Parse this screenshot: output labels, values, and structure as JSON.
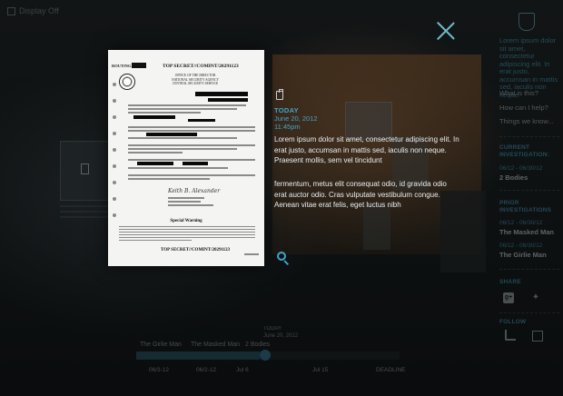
{
  "top_bar": {
    "display_toggle": "Display Off"
  },
  "document": {
    "routing": "ROUTING",
    "classification": "TOP SECRET//COMINT/20291123",
    "office": "OFFICE OF THE DIRECTOR NATIONAL SECURITY AGENCY CENTRAL SECURITY SERVICE",
    "signature": "Keith B. Alexander",
    "special_warning": "Special Warning",
    "footer": "TOP SECRET//COMINT/20291123"
  },
  "detail": {
    "label": "TODAY",
    "date": "June 20, 2012",
    "time": "11:45pm",
    "paragraph1": "Lorem ipsum dolor sit amet, consectetur adipiscing elit. In erat justo, accumsan in mattis sed, iaculis non neque. Praesent mollis, sem vel tincidunt",
    "paragraph2": "fermentum, metus elit consequat odio, id gravida odio erat auctor odio. Cras vulputate vestibulum congue. Aenean vitae erat felis, eget luctus nibh"
  },
  "sidebar": {
    "intro": "Lorem ipsum dolor sit amet, consectetur adipiscing elit. In erat justo, accumsan in mattis sed, iaculis non neque.",
    "links": [
      "What is this?",
      "How can I help?",
      "Things we know..."
    ],
    "current_heading": "CURRENT INVESTIGATION:",
    "current_dates": "06/12 - 06/30/12",
    "current_name": "2 Bodies",
    "prior_heading": "PRIOR INVESTIGATIONS",
    "prior": [
      {
        "dates": "06/12 - 06/30/12",
        "name": "The Masked Man"
      },
      {
        "dates": "06/12 - 06/30/12",
        "name": "The Girlie Man"
      }
    ],
    "share_heading": "SHARE",
    "follow_heading": "FOLLOW",
    "icons": [
      "google-plus-icon",
      "twitter-icon",
      "rss-icon",
      "mail-icon"
    ]
  },
  "timeline": {
    "today": "TODAY",
    "today_date": "June 20, 2012",
    "tags": [
      "The Girlie Man",
      "The Masked Man",
      "2 Bodies"
    ],
    "ticks": [
      "06/3-12",
      "06/2-12",
      "Jul 6",
      "Jul 15",
      "DEADLINE"
    ],
    "progress": 0.47
  },
  "colors": {
    "accent": "#41a5c7",
    "text": "#e9eef0",
    "background": "#0b0d0e"
  }
}
